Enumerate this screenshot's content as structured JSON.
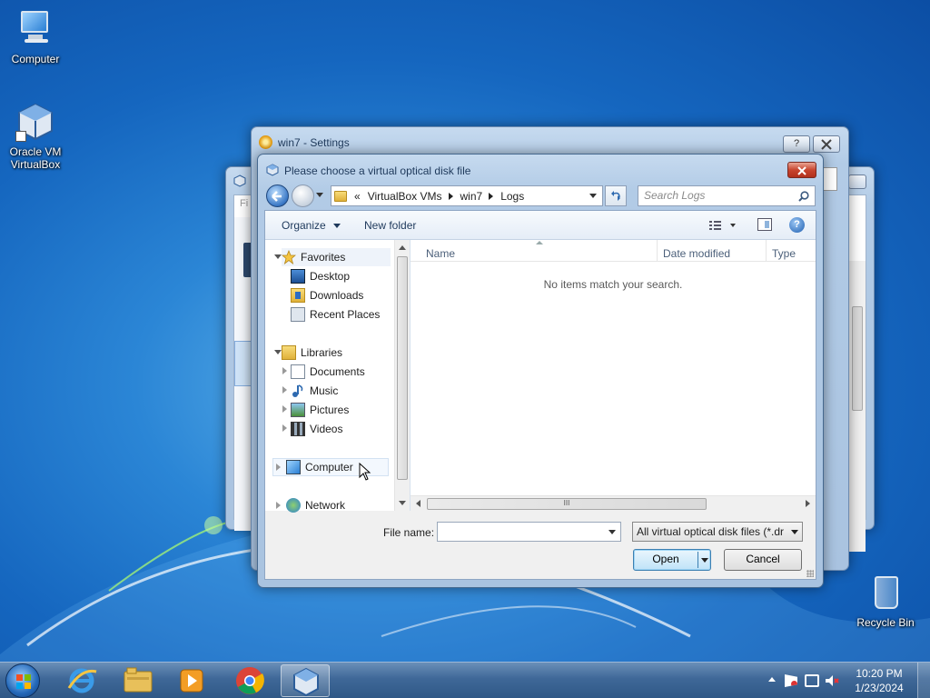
{
  "desktop": {
    "icons": [
      {
        "label": "Computer"
      },
      {
        "label": "Oracle VM VirtualBox"
      },
      {
        "label": "Recycle Bin"
      }
    ]
  },
  "vbox_manager": {
    "menu_fragment": "Fi"
  },
  "settings_window": {
    "title": "win7 - Settings",
    "help_label": "?"
  },
  "dialog": {
    "title": "Please choose a virtual optical disk file",
    "address": {
      "chevron": "«",
      "crumbs": [
        "VirtualBox VMs",
        "win7",
        "Logs"
      ]
    },
    "search_placeholder": "Search Logs",
    "toolbar": {
      "organize": "Organize",
      "new_folder": "New folder"
    },
    "nav": {
      "favorites": "Favorites",
      "favorites_items": [
        "Desktop",
        "Downloads",
        "Recent Places"
      ],
      "libraries": "Libraries",
      "libraries_items": [
        "Documents",
        "Music",
        "Pictures",
        "Videos"
      ],
      "computer": "Computer",
      "network": "Network"
    },
    "columns": {
      "name": "Name",
      "date_modified": "Date modified",
      "type": "Type"
    },
    "empty_message": "No items match your search.",
    "scroll_grip": "III",
    "file_name_label": "File name:",
    "file_name_value": "",
    "file_type": "All virtual optical disk files (*.dr",
    "open_label": "Open",
    "cancel_label": "Cancel"
  },
  "taskbar": {
    "clock_time": "10:20 PM",
    "clock_date": "1/23/2024"
  },
  "colors": {
    "accent": "#1566bf",
    "taskbar": "#3f6898",
    "title_text": "#1e395b"
  }
}
